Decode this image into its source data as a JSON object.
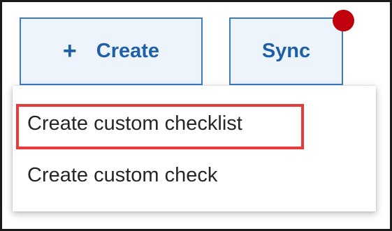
{
  "toolbar": {
    "create_icon": "+",
    "create_label": "Create",
    "sync_label": "Sync"
  },
  "menu": {
    "items": [
      {
        "label": "Create custom checklist"
      },
      {
        "label": "Create custom check"
      }
    ]
  },
  "colors": {
    "accent_text": "#1f5fa8",
    "button_border": "#3d7cc4",
    "button_bg": "#eef4fb",
    "notification": "#c0000d",
    "highlight": "#e53b3b"
  }
}
